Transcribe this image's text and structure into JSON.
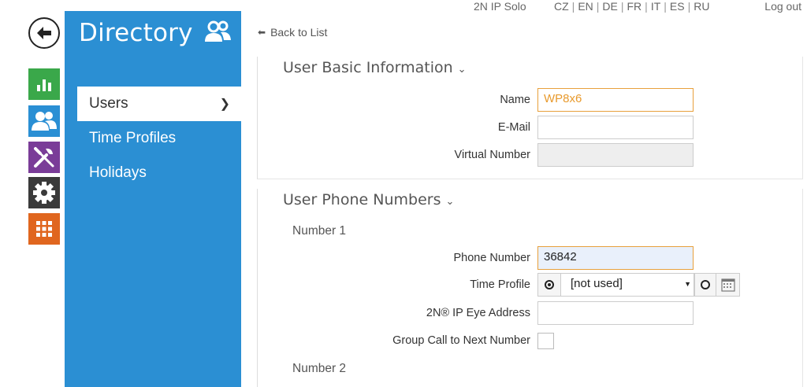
{
  "topbar": {
    "device": "2N IP Solo",
    "languages": [
      "CZ",
      "EN",
      "DE",
      "FR",
      "IT",
      "ES",
      "RU"
    ],
    "logout": "Log out"
  },
  "rail": {
    "icons": [
      "back-arrow-icon",
      "status-chart-icon",
      "users-icon",
      "tools-icon",
      "gear-icon",
      "grid-icon"
    ],
    "colors": {
      "status": "#3aa84a",
      "directory": "#2a8fd4",
      "hardware": "#7a3c98",
      "services": "#3a3a3a",
      "system": "#e0661f"
    }
  },
  "directory": {
    "title": "Directory",
    "accent": "#2b8fd3",
    "nav": [
      {
        "label": "Users",
        "active": true
      },
      {
        "label": "Time Profiles"
      },
      {
        "label": "Holidays"
      }
    ]
  },
  "back_link": "Back to List",
  "basic": {
    "title": "User Basic Information",
    "name_label": "Name",
    "name_value": "WP8x6",
    "email_label": "E-Mail",
    "email_value": "",
    "vnum_label": "Virtual Number",
    "vnum_value": ""
  },
  "phones": {
    "title": "User Phone Numbers",
    "number1": "Number 1",
    "phone_label": "Phone Number",
    "phone_value": "36842",
    "tp_label": "Time Profile",
    "tp_value": "[not used]",
    "eye_label": "2N® IP Eye Address",
    "eye_value": "",
    "group_label": "Group Call to Next Number",
    "number2": "Number 2"
  }
}
